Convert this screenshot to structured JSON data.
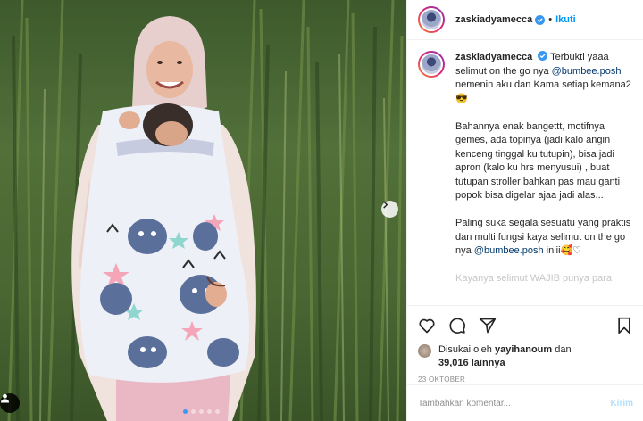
{
  "post": {
    "username": "zaskiadyamecca",
    "follow_label": "Ikuti",
    "separator": "•",
    "caption_username": "zaskiadyamecca",
    "caption_line1_rest": " Terbukti yaaa selimut on the go nya ",
    "caption_mention1": "@bumbee.posh",
    "caption_line1_end": " nemenin aku dan Kama setiap kemana2 😎",
    "caption_para2": "Bahannya enak bangettt, motifnya gemes, ada topinya (jadi kalo angin kenceng tinggal ku tutupin), bisa jadi apron (kalo ku hrs menyusui) , buat tutupan stroller bahkan pas mau ganti popok bisa digelar ajaa jadi alas...",
    "caption_para3": "Paling suka segala sesuatu yang praktis dan multi fungsi kaya selimut on the go nya ",
    "caption_mention2": "@bumbee.posh",
    "caption_para3_end": " iniii🥰♡",
    "caption_truncated": "Kayanya selimut WAJIB punya para",
    "likes_prefix": "Disukai oleh ",
    "likes_user": "yayihanoum",
    "likes_mid": " dan ",
    "likes_count": "39,016",
    "likes_suffix": " lainnya",
    "date": "23 OKTOBER",
    "comment_placeholder": "Tambahkan komentar...",
    "post_button": "Kirim"
  },
  "carousel": {
    "total": 5,
    "active_index": 0
  },
  "icons": {
    "verified": "verified-badge-icon",
    "like": "heart-icon",
    "comment": "comment-icon",
    "share": "share-icon",
    "save": "bookmark-icon",
    "next": "chevron-right-icon",
    "tag": "user-tag-icon"
  },
  "colors": {
    "accent": "#0095f6",
    "verified": "#3897f0",
    "muted": "#8e8e8e"
  }
}
